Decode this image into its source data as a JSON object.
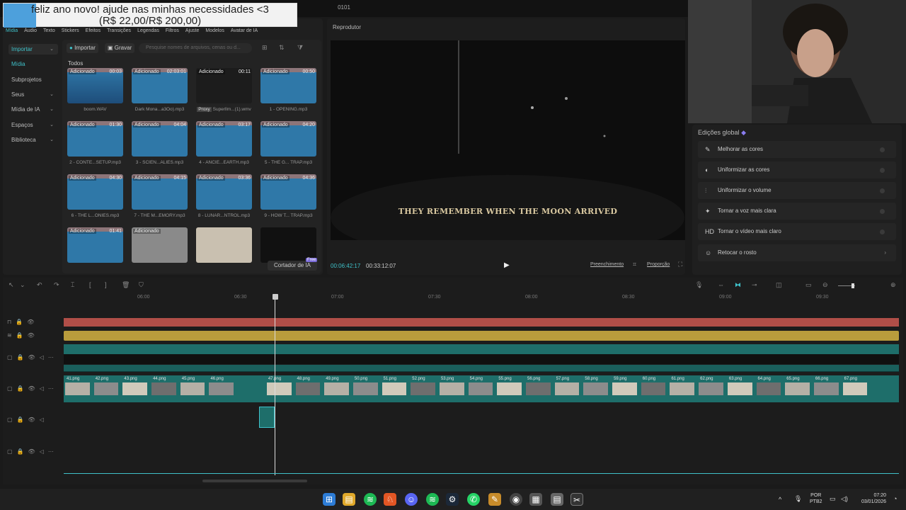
{
  "window": {
    "title": "0101"
  },
  "donation": {
    "line1": "feliz ano novo! ajude nas minhas necessidades <3",
    "line2": "(R$ 22,00/R$ 200,00)",
    "progress": 0.11
  },
  "media_tabs": [
    "Mídia",
    "Áudio",
    "Texto",
    "Stickers",
    "Efeitos",
    "Transições",
    "Legendas",
    "Filtros",
    "Ajuste",
    "Modelos",
    "Avatar de IA"
  ],
  "sidebar": {
    "items": [
      {
        "label": "Importar"
      },
      {
        "label": "Mídia"
      },
      {
        "label": "Subprojetos"
      },
      {
        "label": "Seus"
      },
      {
        "label": "Mídia de IA"
      },
      {
        "label": "Espaços"
      },
      {
        "label": "Biblioteca"
      }
    ]
  },
  "media_toolbar": {
    "import": "Importar",
    "record": "Gravar",
    "search_placeholder": "Pesquise nomes de arquivos, cenas ou d..."
  },
  "media_section": "Todos",
  "added_label": "Adicionado",
  "proxy_label": "Proxy",
  "media_items": [
    {
      "duration": "00:03",
      "name": "boom.WAV"
    },
    {
      "duration": "02:03:01",
      "name": "Dark Mona...a3Oo).mp3"
    },
    {
      "duration": "00:11",
      "name": "Superllm...(1).wmv"
    },
    {
      "duration": "00:50",
      "name": "1 - OPENING.mp3"
    },
    {
      "duration": "01:30",
      "name": "2 - CONTE...SETUP.mp3"
    },
    {
      "duration": "04:04",
      "name": "3 - SCIEN...ALIES.mp3"
    },
    {
      "duration": "03:17",
      "name": "4 - ANCIE...EARTH.mp3"
    },
    {
      "duration": "04:20",
      "name": "5 - THE G... TRAP.mp3"
    },
    {
      "duration": "04:30",
      "name": "6 - THE L...ONIES.mp3"
    },
    {
      "duration": "04:15",
      "name": "7 - THE M...EMORY.mp3"
    },
    {
      "duration": "03:36",
      "name": "8 - LUNAR...NTROL.mp3"
    },
    {
      "duration": "04:36",
      "name": "9 - HOW T... TRAP.mp3"
    },
    {
      "duration": "01:41",
      "name": ""
    },
    {
      "duration": "",
      "name": ""
    },
    {
      "duration": "",
      "name": ""
    },
    {
      "duration": "",
      "name": ""
    }
  ],
  "ai_cutter": {
    "label": "Cortador de IA",
    "badge": "Free"
  },
  "player": {
    "title": "Reprodutor",
    "subtitle": "THEY REMEMBER WHEN THE MOON ARRIVED",
    "time_current": "00:06:42:17",
    "time_total": "00:33:12:07",
    "fill_label": "Preenchimento",
    "ratio_label": "Proporção"
  },
  "global_edits": {
    "title": "Edições global",
    "items": [
      {
        "label": "Melhorar as cores",
        "icon": "✎"
      },
      {
        "label": "Uniformizar as cores",
        "icon": "◐"
      },
      {
        "label": "Uniformizar o volume",
        "icon": "⫶"
      },
      {
        "label": "Tornar a voz mais clara",
        "icon": "✦"
      },
      {
        "label": "Tornar o vídeo mais claro",
        "icon": "HD"
      },
      {
        "label": "Retocar o rosto",
        "icon": "☺"
      }
    ]
  },
  "ruler": [
    "06:00",
    "06:30",
    "07:00",
    "07:30",
    "08:00",
    "08:30",
    "09:00",
    "09:30"
  ],
  "image_clips": [
    "41.png",
    "42.png",
    "43.png",
    "44.png",
    "45.png",
    "46.png",
    "47.png",
    "48.png",
    "49.png",
    "50.png",
    "51.png",
    "52.png",
    "53.png",
    "54.png",
    "55.png",
    "56.png",
    "57.png",
    "58.png",
    "59.png",
    "60.png",
    "61.png",
    "62.png",
    "63.png",
    "64.png",
    "65.png",
    "66.png",
    "67.png"
  ],
  "tray": {
    "lang1": "POR",
    "lang2": "PTB2",
    "time": "07:20",
    "date": "03/01/2026"
  },
  "colors": {
    "accent": "#3fc1c9",
    "audio_track": "#b04e48",
    "gold_track": "#b99c3c",
    "teal_track": "#1e6e6a"
  }
}
